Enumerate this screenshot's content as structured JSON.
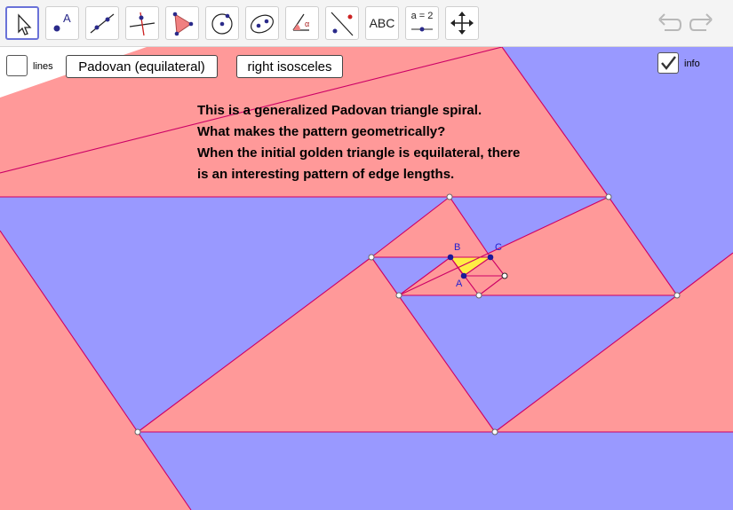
{
  "toolbar": {
    "tools": [
      {
        "name": "move-tool-icon",
        "selected": true
      },
      {
        "name": "point-tool-icon"
      },
      {
        "name": "line-tool-icon"
      },
      {
        "name": "perpendicular-line-tool-icon"
      },
      {
        "name": "polygon-tool-icon"
      },
      {
        "name": "circle-tool-icon"
      },
      {
        "name": "conic-tool-icon"
      },
      {
        "name": "angle-tool-icon"
      },
      {
        "name": "reflect-tool-icon"
      },
      {
        "name": "text-tool-icon",
        "label": "ABC"
      },
      {
        "name": "slider-tool-icon",
        "label": "a = 2"
      },
      {
        "name": "move-graphics-view-tool-icon"
      }
    ],
    "undo_icon": "undo-icon",
    "redo_icon": "redo-icon"
  },
  "controls": {
    "lines_checkbox": {
      "label": "lines",
      "checked": false
    },
    "padovan_button": "Padovan (equilateral)",
    "isosceles_button": "right isosceles",
    "info_checkbox": {
      "label": "info",
      "checked": true
    }
  },
  "info_text": [
    "This is a generalized Padovan triangle spiral.",
    "What makes the pattern geometrically?",
    "When the initial golden triangle is equilateral, there",
    "is an interesting pattern of edge lengths."
  ],
  "points": {
    "A": "A",
    "B": "B",
    "C": "C"
  },
  "colors": {
    "red_region": "#ff9999",
    "blue_region": "#9999ff",
    "edge": "#cc0066",
    "triangle_fill": "#ffee44",
    "point": "#1a1a99",
    "selected_tool_border": "#6a72d8"
  }
}
